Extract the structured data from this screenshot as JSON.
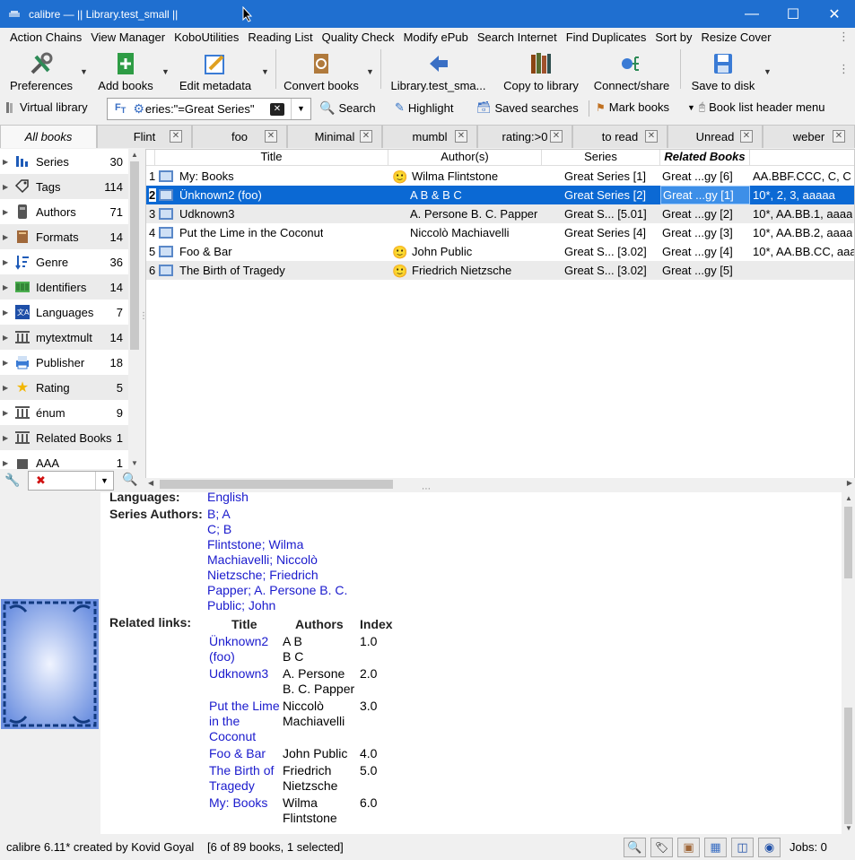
{
  "window": {
    "title": "calibre — || Library.test_small ||"
  },
  "menu": [
    "Action Chains",
    "View Manager",
    "KoboUtilities",
    "Reading List",
    "Quality Check",
    "Modify ePub",
    "Search Internet",
    "Find Duplicates",
    "Sort by",
    "Resize Cover"
  ],
  "toolbar": {
    "preferences": "Preferences",
    "add_books": "Add books",
    "edit_metadata": "Edit metadata",
    "convert_books": "Convert books",
    "library": "Library.test_sma...",
    "copy_to_library": "Copy to library",
    "connect_share": "Connect/share",
    "save_to_disk": "Save to disk"
  },
  "searchbar": {
    "virtual_library": "Virtual library",
    "query": "eries:\"=Great Series\"",
    "search": "Search",
    "highlight": "Highlight",
    "saved_searches": "Saved searches",
    "mark_books": "Mark books",
    "book_list_header_menu": "Book list header menu"
  },
  "tabs": [
    "All books",
    "Flint",
    "foo",
    "Minimal",
    "mumbl",
    "rating:>0",
    "to read",
    "Unread",
    "weber"
  ],
  "tag_browser": [
    {
      "label": "Series",
      "count": "30",
      "icon": "series-icon"
    },
    {
      "label": "Tags",
      "count": "114",
      "icon": "tag-icon"
    },
    {
      "label": "Authors",
      "count": "71",
      "icon": "authors-icon"
    },
    {
      "label": "Formats",
      "count": "14",
      "icon": "book-icon"
    },
    {
      "label": "Genre",
      "count": "36",
      "icon": "genre-icon"
    },
    {
      "label": "Identifiers",
      "count": "14",
      "icon": "barcode-icon"
    },
    {
      "label": "Languages",
      "count": "7",
      "icon": "languages-icon"
    },
    {
      "label": "mytextmult",
      "count": "14",
      "icon": "column-icon"
    },
    {
      "label": "Publisher",
      "count": "18",
      "icon": "publisher-icon"
    },
    {
      "label": "Rating",
      "count": "5",
      "icon": "star-icon"
    },
    {
      "label": "énum",
      "count": "9",
      "icon": "column-icon"
    },
    {
      "label": "Related Books",
      "count": "1",
      "icon": "column-icon"
    },
    {
      "label": "AAA",
      "count": "1",
      "icon": "column-icon"
    }
  ],
  "book_list": {
    "headers": [
      "Title",
      "Author(s)",
      "Series",
      "Related Books"
    ],
    "rows": [
      {
        "num": "1",
        "title": "My: Books",
        "author": "Wilma Flintstone",
        "series": "Great Series [1]",
        "related": "Great ...gy [6]",
        "extra": "AA.BBF.CCC, C, C",
        "smiley": true
      },
      {
        "num": "2",
        "title": "Ünknown2 (foo)",
        "author": "A B & B C",
        "series": "Great Series [2]",
        "related": "Great ...gy [1]",
        "extra": "10*, 2, 3, aaaaa",
        "smiley": false
      },
      {
        "num": "3",
        "title": "Udknown3",
        "author": "A. Persone B. C. Papper",
        "series": "Great S... [5.01]",
        "related": "Great ...gy [2]",
        "extra": "10*, AA.BB.1, aaaa",
        "smiley": false
      },
      {
        "num": "4",
        "title": "Put the Lime in the Coconut",
        "author": "Niccolò Machiavelli",
        "series": "Great Series [4]",
        "related": "Great ...gy [3]",
        "extra": "10*, AA.BB.2, aaaa",
        "smiley": false
      },
      {
        "num": "5",
        "title": "Foo & Bar",
        "author": "John Public",
        "series": "Great S... [3.02]",
        "related": "Great ...gy [4]",
        "extra": "10*, AA.BB.CC, aaa",
        "smiley": true
      },
      {
        "num": "6",
        "title": "The Birth of Tragedy",
        "author": "Friedrich Nietzsche",
        "series": "Great S... [3.02]",
        "related": "Great ...gy [5]",
        "extra": "",
        "smiley": true
      }
    ]
  },
  "details": {
    "languages_label": "Languages:",
    "languages_value": "English",
    "series_authors_label": "Series Authors:",
    "series_authors": [
      "B; A",
      "C; B",
      "Flintstone; Wilma",
      "Machiavelli; Niccolò",
      "Nietzsche; Friedrich",
      "Papper; A. Persone B. C.",
      "Public; John"
    ],
    "related_links_label": "Related links:",
    "related_headers": [
      "Title",
      "Authors",
      "Index"
    ],
    "related": [
      {
        "title": [
          "Ünknown2",
          "(foo)"
        ],
        "authors": [
          "A B",
          "B C"
        ],
        "index": "1.0"
      },
      {
        "title": [
          "Udknown3"
        ],
        "authors": [
          "A. Persone",
          "B. C. Papper"
        ],
        "index": "2.0"
      },
      {
        "title": [
          "Put the Lime",
          "in the",
          "Coconut"
        ],
        "authors": [
          "Niccolò",
          "Machiavelli"
        ],
        "index": "3.0"
      },
      {
        "title": [
          "Foo & Bar"
        ],
        "authors": [
          "John Public"
        ],
        "index": "4.0"
      },
      {
        "title": [
          "The Birth of",
          "Tragedy"
        ],
        "authors": [
          "Friedrich",
          "Nietzsche"
        ],
        "index": "5.0"
      },
      {
        "title": [
          "My: Books"
        ],
        "authors": [
          "Wilma",
          "Flintstone"
        ],
        "index": "6.0"
      }
    ]
  },
  "status": {
    "left": "calibre 6.11* created by Kovid Goyal",
    "count": "[6 of 89 books, 1 selected]",
    "jobs": "Jobs: 0"
  },
  "colors": {
    "titlebar": "#1f6fd0",
    "selection": "#0b69d4",
    "link": "#1a1acd"
  }
}
